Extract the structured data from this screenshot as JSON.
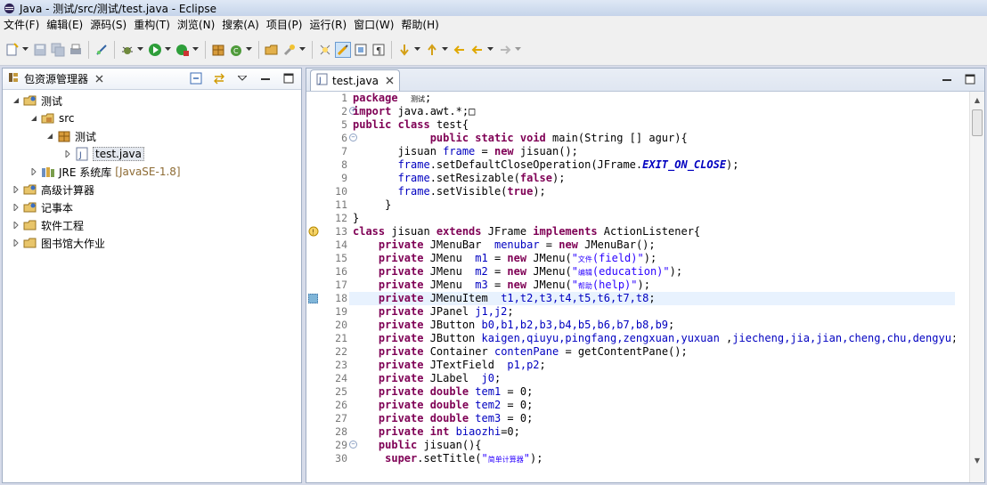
{
  "window": {
    "title": "Java - 测试/src/测试/test.java - Eclipse"
  },
  "menubar": [
    "文件(F)",
    "编辑(E)",
    "源码(S)",
    "重构(T)",
    "浏览(N)",
    "搜索(A)",
    "项目(P)",
    "运行(R)",
    "窗口(W)",
    "帮助(H)"
  ],
  "package_explorer": {
    "tab_label": "包资源管理器",
    "tree": [
      {
        "label": "测试",
        "level": 0,
        "expanded": true
      },
      {
        "label": "src",
        "level": 1,
        "expanded": true
      },
      {
        "label": "测试",
        "level": 2,
        "expanded": true
      },
      {
        "label": "test.java",
        "level": 3,
        "expanded": false,
        "selected": true
      },
      {
        "label": "JRE 系统库",
        "extra": "[JavaSE-1.8]",
        "level": 1,
        "expanded": false
      },
      {
        "label": "高级计算器",
        "level": 0,
        "expanded": false
      },
      {
        "label": "记事本",
        "level": 0,
        "expanded": false
      },
      {
        "label": "软件工程",
        "level": 0,
        "expanded": false
      },
      {
        "label": "图书馆大作业",
        "level": 0,
        "expanded": false
      }
    ]
  },
  "editor": {
    "tab_label": "test.java",
    "lines": [
      {
        "n": "1",
        "segs": [
          [
            "kw",
            "package"
          ],
          [
            "",
            "  "
          ],
          [
            "tiny",
            "测试"
          ],
          [
            "",
            ";"
          ]
        ]
      },
      {
        "n": "2",
        "fold": "+",
        "segs": [
          [
            "kw",
            "import"
          ],
          [
            "",
            " java.awt.*;"
          ],
          [
            "",
            "□"
          ]
        ]
      },
      {
        "n": "5",
        "segs": [
          [
            "kw",
            "public"
          ],
          [
            "",
            ""
          ],
          [
            "kw",
            " class"
          ],
          [
            "",
            " test{"
          ]
        ]
      },
      {
        "n": "6",
        "fold": "−",
        "segs": [
          [
            "",
            "            "
          ],
          [
            "kw",
            "public"
          ],
          [
            "",
            ""
          ],
          [
            "kw",
            " static"
          ],
          [
            "",
            ""
          ],
          [
            "kw",
            " void"
          ],
          [
            "",
            " main(String [] agur){"
          ]
        ]
      },
      {
        "n": "7",
        "segs": [
          [
            "",
            "       jisuan "
          ],
          [
            "fld",
            "frame"
          ],
          [
            "",
            " = "
          ],
          [
            "kw",
            "new"
          ],
          [
            "",
            " jisuan();"
          ]
        ]
      },
      {
        "n": "8",
        "segs": [
          [
            "",
            "       "
          ],
          [
            "fld",
            "frame"
          ],
          [
            "",
            ".setDefaultCloseOperation(JFrame."
          ],
          [
            "sti",
            "EXIT_ON_CLOSE"
          ],
          [
            "",
            ");"
          ]
        ]
      },
      {
        "n": "9",
        "segs": [
          [
            "",
            "       "
          ],
          [
            "fld",
            "frame"
          ],
          [
            "",
            ".setResizable("
          ],
          [
            "kw",
            "false"
          ],
          [
            "",
            ");"
          ]
        ]
      },
      {
        "n": "10",
        "segs": [
          [
            "",
            "       "
          ],
          [
            "fld",
            "frame"
          ],
          [
            "",
            ".setVisible("
          ],
          [
            "kw",
            "true"
          ],
          [
            "",
            ");"
          ]
        ]
      },
      {
        "n": "11",
        "segs": [
          [
            "",
            "     }"
          ]
        ]
      },
      {
        "n": "12",
        "segs": [
          [
            "",
            "}"
          ]
        ]
      },
      {
        "n": "13",
        "segs": [
          [
            "kw",
            "class"
          ],
          [
            "",
            " jisuan "
          ],
          [
            "kw",
            "extends"
          ],
          [
            "",
            " JFrame "
          ],
          [
            "kw",
            "implements"
          ],
          [
            "",
            " ActionListener{"
          ]
        ]
      },
      {
        "n": "14",
        "segs": [
          [
            "",
            "    "
          ],
          [
            "kw",
            "private"
          ],
          [
            "",
            " JMenuBar  "
          ],
          [
            "fld",
            "menubar"
          ],
          [
            "",
            " = "
          ],
          [
            "kw",
            "new"
          ],
          [
            "",
            " JMenuBar();"
          ]
        ]
      },
      {
        "n": "15",
        "segs": [
          [
            "",
            "    "
          ],
          [
            "kw",
            "private"
          ],
          [
            "",
            " JMenu  "
          ],
          [
            "fld",
            "m1"
          ],
          [
            "",
            " = "
          ],
          [
            "kw",
            "new"
          ],
          [
            "",
            " JMenu("
          ],
          [
            "st",
            "\""
          ],
          [
            "tiny st",
            "文件"
          ],
          [
            "st",
            "(field)\""
          ],
          [
            "",
            ");"
          ]
        ]
      },
      {
        "n": "16",
        "segs": [
          [
            "",
            "    "
          ],
          [
            "kw",
            "private"
          ],
          [
            "",
            " JMenu  "
          ],
          [
            "fld",
            "m2"
          ],
          [
            "",
            " = "
          ],
          [
            "kw",
            "new"
          ],
          [
            "",
            " JMenu("
          ],
          [
            "st",
            "\""
          ],
          [
            "tiny st",
            "编辑"
          ],
          [
            "st",
            "(education)\""
          ],
          [
            "",
            ");"
          ]
        ]
      },
      {
        "n": "17",
        "segs": [
          [
            "",
            "    "
          ],
          [
            "kw",
            "private"
          ],
          [
            "",
            " JMenu  "
          ],
          [
            "fld",
            "m3"
          ],
          [
            "",
            " = "
          ],
          [
            "kw",
            "new"
          ],
          [
            "",
            " JMenu("
          ],
          [
            "st",
            "\""
          ],
          [
            "tiny st",
            "帮助"
          ],
          [
            "st",
            "(help)\""
          ],
          [
            "",
            ");"
          ]
        ]
      },
      {
        "n": "18",
        "cur": true,
        "segs": [
          [
            "",
            "    "
          ],
          [
            "kw",
            "private"
          ],
          [
            "",
            " JMenuItem  "
          ],
          [
            "fld",
            "t1,t2,t3,t4,t5,t6,t7,t8"
          ],
          [
            "",
            ";"
          ]
        ]
      },
      {
        "n": "19",
        "segs": [
          [
            "",
            "    "
          ],
          [
            "kw",
            "private"
          ],
          [
            "",
            " JPanel "
          ],
          [
            "fld",
            "j1,j2"
          ],
          [
            "",
            ";"
          ]
        ]
      },
      {
        "n": "20",
        "segs": [
          [
            "",
            "    "
          ],
          [
            "kw",
            "private"
          ],
          [
            "",
            " JButton "
          ],
          [
            "fld",
            "b0,b1,b2,b3,b4,b5,b6,b7,b8,b9"
          ],
          [
            "",
            ";"
          ]
        ]
      },
      {
        "n": "21",
        "segs": [
          [
            "",
            "    "
          ],
          [
            "kw",
            "private"
          ],
          [
            "",
            " JButton "
          ],
          [
            "fld",
            "kaigen,qiuyu,pingfang,zengxuan,yuxuan"
          ],
          [
            "",
            " ,"
          ],
          [
            "fld",
            "jiecheng,jia,jian,cheng,chu,dengyu"
          ],
          [
            "",
            ";"
          ]
        ]
      },
      {
        "n": "22",
        "segs": [
          [
            "",
            "    "
          ],
          [
            "kw",
            "private"
          ],
          [
            "",
            " Container "
          ],
          [
            "fld",
            "contenPane"
          ],
          [
            "",
            " = getContentPane();"
          ]
        ]
      },
      {
        "n": "23",
        "segs": [
          [
            "",
            "    "
          ],
          [
            "kw",
            "private"
          ],
          [
            "",
            " JTextField  "
          ],
          [
            "fld",
            "p1,p2"
          ],
          [
            "",
            ";"
          ]
        ]
      },
      {
        "n": "24",
        "segs": [
          [
            "",
            "    "
          ],
          [
            "kw",
            "private"
          ],
          [
            "",
            " JLabel  "
          ],
          [
            "fld",
            "j0"
          ],
          [
            "",
            ";"
          ]
        ]
      },
      {
        "n": "25",
        "segs": [
          [
            "",
            "    "
          ],
          [
            "kw",
            "private"
          ],
          [
            "",
            ""
          ],
          [
            "kw",
            " double"
          ],
          [
            "",
            " "
          ],
          [
            "fld",
            "tem1"
          ],
          [
            "",
            " = 0;"
          ]
        ]
      },
      {
        "n": "26",
        "segs": [
          [
            "",
            "    "
          ],
          [
            "kw",
            "private"
          ],
          [
            "",
            ""
          ],
          [
            "kw",
            " double"
          ],
          [
            "",
            " "
          ],
          [
            "fld",
            "tem2"
          ],
          [
            "",
            " = 0;"
          ]
        ]
      },
      {
        "n": "27",
        "segs": [
          [
            "",
            "    "
          ],
          [
            "kw",
            "private"
          ],
          [
            "",
            ""
          ],
          [
            "kw",
            " double"
          ],
          [
            "",
            " "
          ],
          [
            "fld",
            "tem3"
          ],
          [
            "",
            " = 0;"
          ]
        ]
      },
      {
        "n": "28",
        "segs": [
          [
            "",
            "    "
          ],
          [
            "kw",
            "private"
          ],
          [
            "",
            ""
          ],
          [
            "kw",
            " int"
          ],
          [
            "",
            " "
          ],
          [
            "fld",
            "biaozhi"
          ],
          [
            "",
            "=0;"
          ]
        ]
      },
      {
        "n": "29",
        "fold": "−",
        "segs": [
          [
            "",
            "    "
          ],
          [
            "kw",
            "public"
          ],
          [
            "",
            " jisuan(){"
          ]
        ]
      },
      {
        "n": "30",
        "segs": [
          [
            "",
            "     "
          ],
          [
            "kw",
            "super"
          ],
          [
            "",
            ".setTitle("
          ],
          [
            "st",
            "\""
          ],
          [
            "tiny st",
            "简单计算器"
          ],
          [
            "st",
            "\""
          ],
          [
            "",
            ");"
          ]
        ]
      }
    ]
  }
}
